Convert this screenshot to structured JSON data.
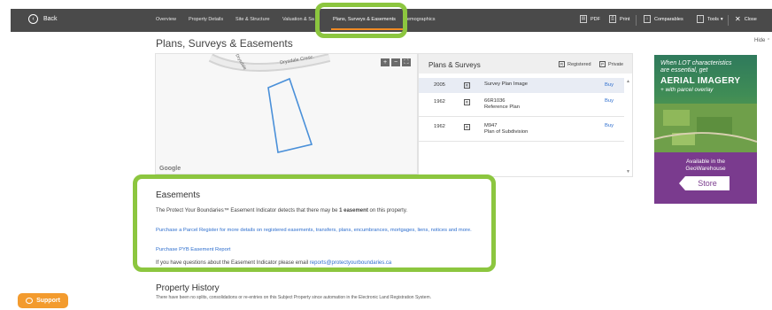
{
  "nav": {
    "back_label": "Back",
    "tabs": [
      {
        "label": "Overview"
      },
      {
        "label": "Property Details"
      },
      {
        "label": "Site & Structure"
      },
      {
        "label": "Valuation & Sa"
      },
      {
        "label": "Plans, Surveys & Easements"
      },
      {
        "label": "Demographics"
      }
    ],
    "active_tab": "Plans, Surveys & Easements",
    "active_color": "#f08a24",
    "tools": {
      "pdf": "PDF",
      "print": "Print",
      "comparables": "Comparables",
      "tools": "Tools",
      "tools_chevron": "▾",
      "close": "Close"
    }
  },
  "page": {
    "title": "Plans, Surveys & Easements",
    "hide_label": "Hide",
    "hide_chevron": "⌃"
  },
  "map": {
    "street_label_1": "Drysdale Cresc.",
    "street_label_2": "Drysdale",
    "zoom_in": "+",
    "zoom_out": "−",
    "fullscreen": "⛶",
    "attribution": "Google",
    "parcel_color": "#4a90d9"
  },
  "plans": {
    "title": "Plans & Surveys",
    "legend": [
      {
        "code": "R",
        "label": "Registered"
      },
      {
        "code": "P",
        "label": "Private"
      }
    ],
    "rows": [
      {
        "year": "2005",
        "code": "R",
        "name": "Survey Plan Image",
        "name2": "",
        "action": "Buy"
      },
      {
        "year": "1962",
        "code": "R",
        "name": "66R1036",
        "name2": "Reference Plan",
        "action": "Buy"
      },
      {
        "year": "1962",
        "code": "R",
        "name": "M947",
        "name2": "Plan of Subdivision",
        "action": "Buy"
      }
    ]
  },
  "ad": {
    "line1": "When LOT characteristics",
    "line2": "are essential, get",
    "line3": "AERIAL IMAGERY",
    "line4": "+ with parcel overlay",
    "available": "Available in the",
    "brand": "GeoWarehouse",
    "store_label": "Store"
  },
  "easements": {
    "title": "Easements",
    "indicator_pre": "The Protect Your Boundaries™ Easement Indicator detects that there may be",
    "indicator_count": "1 easement",
    "indicator_post": "on this property.",
    "register_link": "Purchase a Parcel Register for more details on registered easements, transfers, plans, encumbrances, mortgages, liens, notices and more.",
    "report_link": "Purchase PYB Easement Report",
    "question_pre": "If you have questions about the Easement Indicator please email",
    "email": "reports@protectyourboundaries.ca"
  },
  "history": {
    "title": "Property History",
    "text": "There have been no splits, consolidations or re-entries on this Subject Property since automation in the Electronic Land Registration System."
  },
  "support": {
    "label": "Support"
  },
  "highlight_color": "#8cc63f"
}
